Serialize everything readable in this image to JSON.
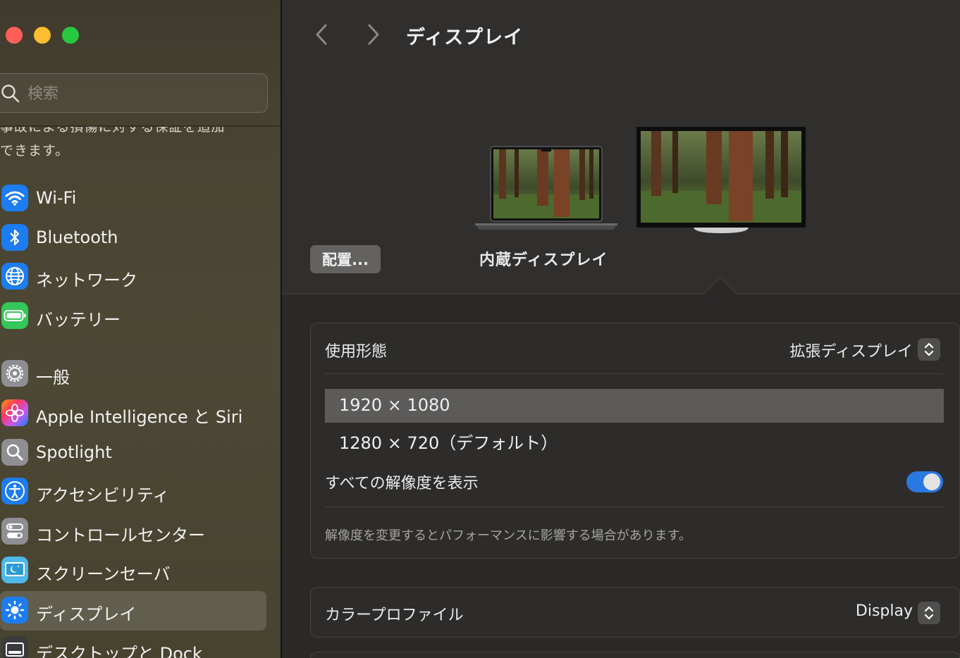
{
  "window": {
    "traffic_lights": [
      "close",
      "minimize",
      "zoom"
    ]
  },
  "sidebar": {
    "search_placeholder": "検索",
    "promo_line1": "事故による損傷に対する保証を追加",
    "promo_line2": "できます。",
    "items": [
      {
        "label": "Wi-Fi",
        "icon": "wifi-icon",
        "color": "#1c7cf2"
      },
      {
        "label": "Bluetooth",
        "icon": "bluetooth-icon",
        "color": "#1c7cf2"
      },
      {
        "label": "ネットワーク",
        "icon": "globe-icon",
        "color": "#1c7cf2"
      },
      {
        "label": "バッテリー",
        "icon": "battery-icon",
        "color": "#34c759"
      },
      {
        "label": "一般",
        "icon": "gear-icon",
        "color": "#8e8e93"
      },
      {
        "label": "Apple Intelligence と Siri",
        "icon": "siri-icon",
        "color": "#e05bd0"
      },
      {
        "label": "Spotlight",
        "icon": "magnifier-icon",
        "color": "#8e8e93"
      },
      {
        "label": "アクセシビリティ",
        "icon": "accessibility-icon",
        "color": "#1c7cf2"
      },
      {
        "label": "コントロールセンター",
        "icon": "control-center-icon",
        "color": "#8e8e93"
      },
      {
        "label": "スクリーンセーバ",
        "icon": "screensaver-icon",
        "color": "#4fb8e8"
      },
      {
        "label": "ディスプレイ",
        "icon": "display-sun-icon",
        "color": "#1c7cf2",
        "selected": true
      },
      {
        "label": "デスクトップと Dock",
        "icon": "dock-icon",
        "color": "#3a3a3c"
      }
    ]
  },
  "header": {
    "title": "ディスプレイ"
  },
  "displays": {
    "arrange_label": "配置...",
    "builtin_label": "内蔵ディスプレイ"
  },
  "usage_panel": {
    "label": "使用形態",
    "value": "拡張ディスプレイ",
    "resolutions": [
      "1920 × 1080",
      "1280 × 720（デフォルト）"
    ],
    "selected_resolution": "1920 × 1080",
    "show_all_label": "すべての解像度を表示",
    "show_all_on": true,
    "note": "解像度を変更するとパフォーマンスに影響する場合があります。"
  },
  "color_panel": {
    "label": "カラープロファイル",
    "value": "Display"
  },
  "colors": {
    "accent": "#2a79e3",
    "selection": "#5c5b59"
  }
}
